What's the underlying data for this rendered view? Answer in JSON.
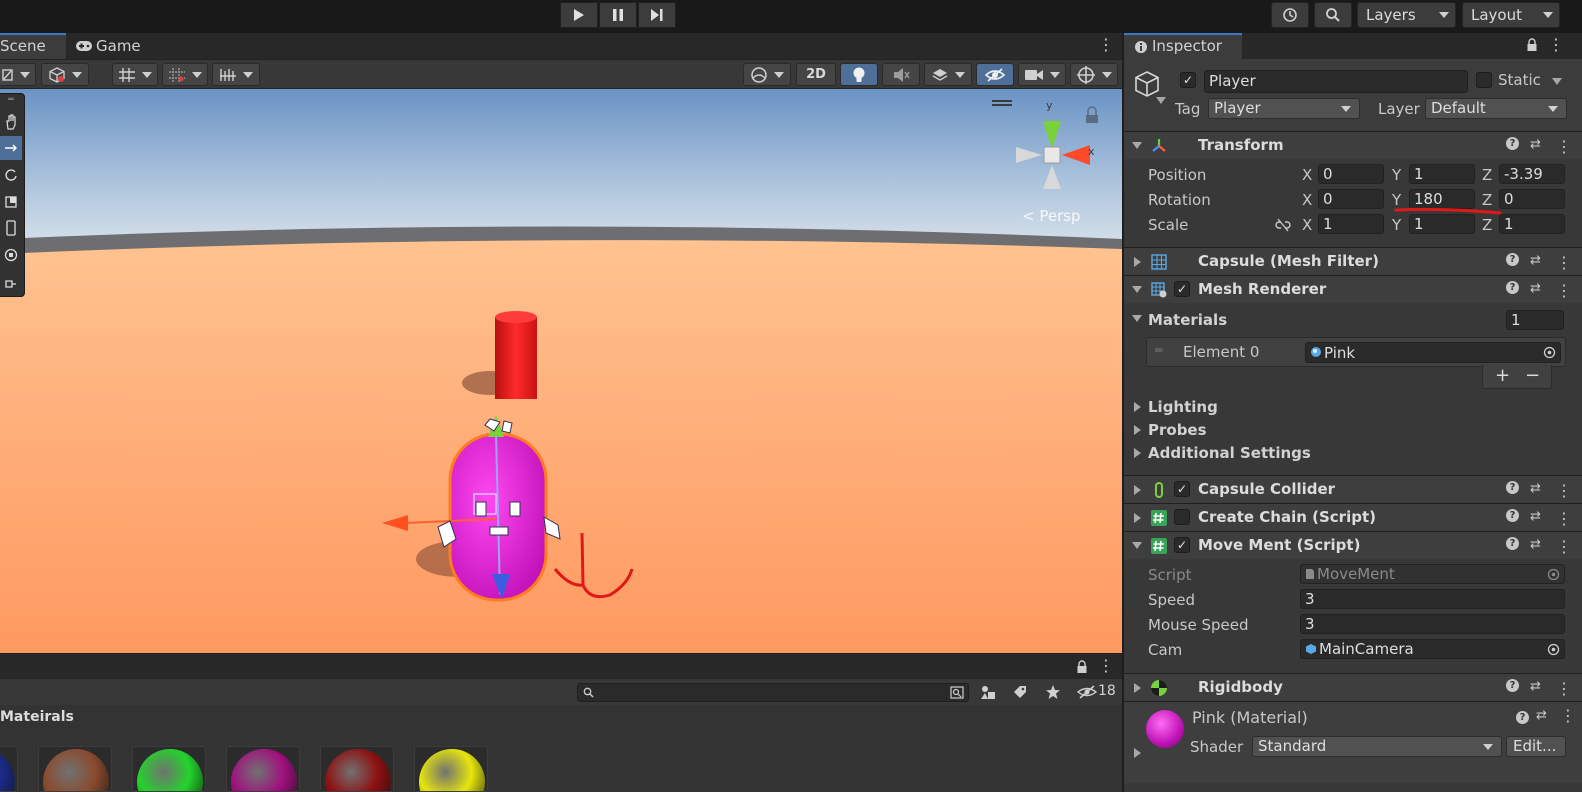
{
  "toolbar": {
    "play_icon": "play-icon",
    "pause_icon": "pause-icon",
    "step_icon": "step-icon",
    "layers_label": "Layers",
    "layout_label": "Layout"
  },
  "scene": {
    "tabs": [
      {
        "label": "Scene"
      },
      {
        "label": "Game"
      }
    ],
    "toggle_2d": "2D",
    "gizmo_y": "y",
    "gizmo_x": "x",
    "persp_label": "< Persp"
  },
  "project": {
    "hidden_count": "18",
    "breadcrumb": "Mateirals",
    "materials": [
      {
        "color": "#1b2a8a"
      },
      {
        "color": "#8a4a2e"
      },
      {
        "color": "#22d42a"
      },
      {
        "color": "#a0107e"
      },
      {
        "color": "#8e1010"
      },
      {
        "color": "#e6e60e"
      }
    ]
  },
  "inspector": {
    "tab_label": "Inspector",
    "object_name": "Player",
    "static_label": "Static",
    "tag_label": "Tag",
    "tag_value": "Player",
    "layer_label": "Layer",
    "layer_value": "Default",
    "transform": {
      "title": "Transform",
      "position_label": "Position",
      "rotation_label": "Rotation",
      "scale_label": "Scale",
      "axis_x": "X",
      "axis_y": "Y",
      "axis_z": "Z",
      "position": {
        "x": "0",
        "y": "1",
        "z": "-3.39"
      },
      "rotation": {
        "x": "0",
        "y": "180",
        "z": "0"
      },
      "scale": {
        "x": "1",
        "y": "1",
        "z": "1"
      }
    },
    "mesh_filter_title": "Capsule (Mesh Filter)",
    "mesh_renderer": {
      "title": "Mesh Renderer",
      "materials_label": "Materials",
      "materials_count": "1",
      "element_label": "Element 0",
      "element_value": "Pink",
      "add_label": "+",
      "remove_label": "−",
      "lighting_label": "Lighting",
      "probes_label": "Probes",
      "additional_label": "Additional Settings"
    },
    "capsule_collider_title": "Capsule Collider",
    "create_chain_title": "Create Chain (Script)",
    "movement": {
      "title": "Move Ment (Script)",
      "script_label": "Script",
      "script_value": "MoveMent",
      "speed_label": "Speed",
      "speed_value": "3",
      "mouse_speed_label": "Mouse Speed",
      "mouse_speed_value": "3",
      "cam_label": "Cam",
      "cam_value": "MainCamera"
    },
    "rigidbody_title": "Rigidbody",
    "material_asset": {
      "title": "Pink (Material)",
      "shader_label": "Shader",
      "shader_value": "Standard",
      "edit_label": "Edit..."
    }
  },
  "colors": {
    "accent": "#4d6f98",
    "sky_top": "#6a93c5",
    "ground": "#ffa268",
    "capsule": "#e81ed0",
    "annotation": "#e01818"
  }
}
